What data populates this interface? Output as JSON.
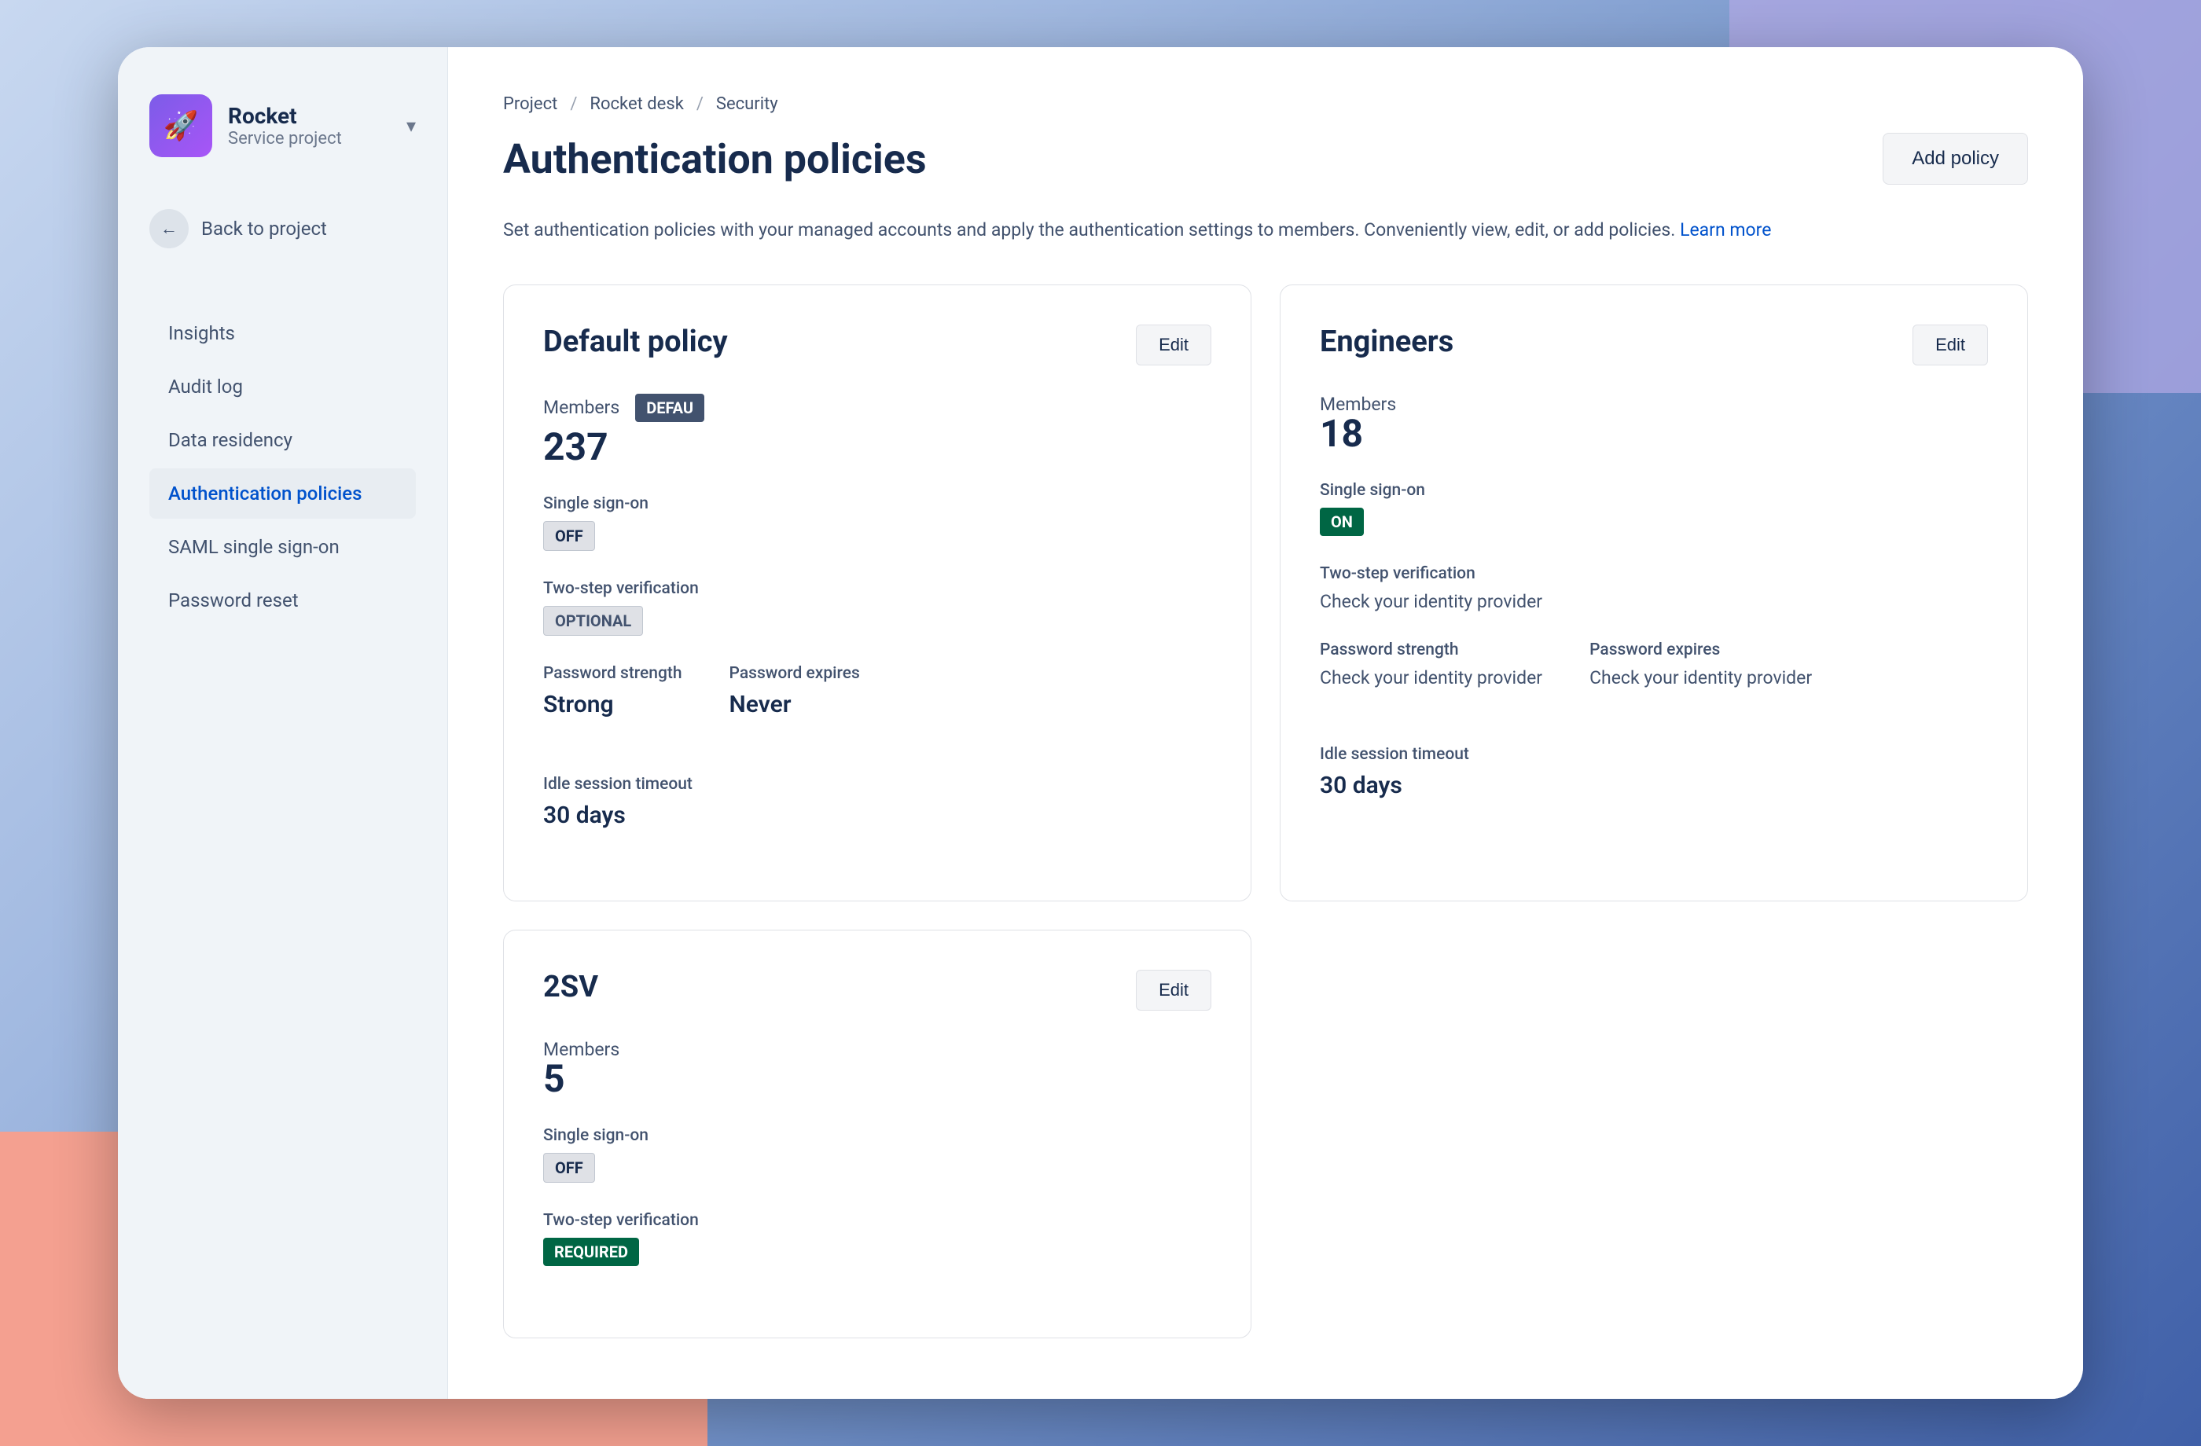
{
  "brand": {
    "name": "Rocket",
    "subtitle": "Service project",
    "logo_emoji": "🚀"
  },
  "back_button": {
    "label": "Back to project"
  },
  "sidebar": {
    "items": [
      {
        "id": "insights",
        "label": "Insights",
        "active": false
      },
      {
        "id": "audit-log",
        "label": "Audit log",
        "active": false
      },
      {
        "id": "data-residency",
        "label": "Data residency",
        "active": false
      },
      {
        "id": "authentication-policies",
        "label": "Authentication policies",
        "active": true
      },
      {
        "id": "saml-sso",
        "label": "SAML single sign-on",
        "active": false
      },
      {
        "id": "password-reset",
        "label": "Password reset",
        "active": false
      }
    ]
  },
  "breadcrumb": {
    "items": [
      "Project",
      "Rocket desk",
      "Security"
    ]
  },
  "page": {
    "title": "Authentication policies",
    "description": "Set authentication policies with your managed accounts and apply the authentication settings to members. Conveniently view, edit, or add policies.",
    "learn_more": "Learn more",
    "add_policy_label": "Add policy"
  },
  "policies": [
    {
      "id": "default",
      "title": "Default policy",
      "edit_label": "Edit",
      "members_label": "Members",
      "members_count": "237",
      "members_badge": "DEFAU",
      "members_badge_type": "default",
      "sso_label": "Single sign-on",
      "sso_badge": "OFF",
      "sso_badge_type": "off",
      "two_step_label": "Two-step verification",
      "two_step_badge": "OPTIONAL",
      "two_step_badge_type": "optional",
      "password_strength_label": "Password strength",
      "password_strength_value": "Strong",
      "password_expires_label": "Password expires",
      "password_expires_value": "Never",
      "idle_session_label": "Idle session timeout",
      "idle_session_value": "30 days"
    },
    {
      "id": "engineers",
      "title": "Engineers",
      "edit_label": "Edit",
      "members_label": "Members",
      "members_count": "18",
      "members_badge": null,
      "sso_label": "Single sign-on",
      "sso_badge": "ON",
      "sso_badge_type": "on",
      "two_step_label": "Two-step verification",
      "two_step_value": "Check your identity provider",
      "password_strength_label": "Password strength",
      "password_strength_value": "Check your identity provider",
      "password_expires_label": "Password expires",
      "password_expires_value": "Check your identity provider",
      "idle_session_label": "Idle session timeout",
      "idle_session_value": "30 days"
    },
    {
      "id": "2sv",
      "title": "2SV",
      "edit_label": "Edit",
      "members_label": "Members",
      "members_count": "5",
      "members_badge": null,
      "sso_label": "Single sign-on",
      "sso_badge": "OFF",
      "sso_badge_type": "off",
      "two_step_label": "Two-step verification",
      "two_step_badge": "REQUIRED",
      "two_step_badge_type": "required"
    }
  ]
}
